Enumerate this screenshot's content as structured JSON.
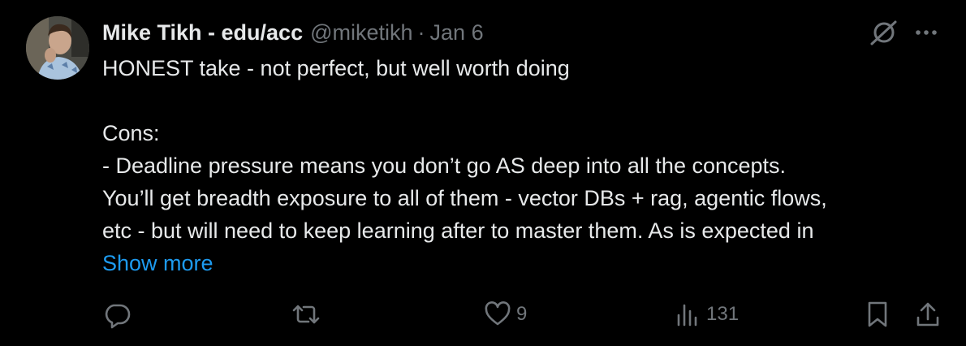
{
  "tweet": {
    "author": {
      "display_name": "Mike Tikh - edu/acc",
      "handle": "@miketikh",
      "separator": "·",
      "date": "Jan 6"
    },
    "text_lines": [
      "HONEST take - not perfect, but well worth doing",
      "",
      "Cons:",
      "- Deadline pressure means you don’t go AS deep into all the concepts.",
      "You’ll get breadth exposure to all of them - vector DBs + rag, agentic flows,",
      "etc - but will need to keep learning after to master them. As is expected in"
    ],
    "show_more_label": "Show more",
    "icons": {
      "top_right": [
        "grok-icon",
        "more-icon"
      ],
      "actions": [
        "reply-icon",
        "retweet-icon",
        "like-icon",
        "views-icon",
        "bookmark-icon",
        "share-icon"
      ]
    },
    "stats": {
      "likes": "9",
      "views": "131"
    },
    "colors": {
      "background": "#000000",
      "text": "#e7e9ea",
      "muted": "#71767b",
      "link": "#1d9bf0"
    }
  }
}
